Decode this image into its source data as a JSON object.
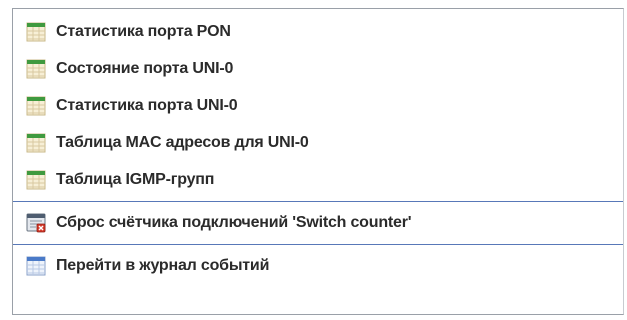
{
  "menu": {
    "items": [
      {
        "label": "Статистика порта PON",
        "icon": "table-green-icon"
      },
      {
        "label": "Состояние порта UNI-0",
        "icon": "table-green-icon"
      },
      {
        "label": "Статистика порта UNI-0",
        "icon": "table-green-icon"
      },
      {
        "label": "Таблица MAC адресов для UNI-0",
        "icon": "table-green-icon"
      },
      {
        "label": "Таблица IGMP-групп",
        "icon": "table-green-icon"
      }
    ],
    "reset_item": {
      "label": "Сброс счётчика подключений 'Switch counter'",
      "icon": "reset-counter-icon"
    },
    "log_item": {
      "label": "Перейти в журнал событий",
      "icon": "event-log-icon"
    }
  },
  "colors": {
    "separator": "#5878b8",
    "table_header": "#3f9a3f",
    "table_grid": "#d8c9a0",
    "log_header": "#4a7ac8"
  }
}
